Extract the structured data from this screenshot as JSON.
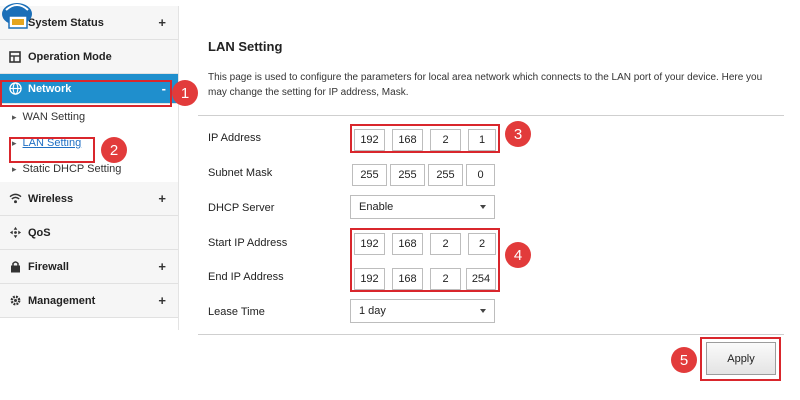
{
  "sidebar": {
    "items": [
      {
        "label": "System Status",
        "icon": "status-icon"
      },
      {
        "label": "Operation Mode",
        "icon": "mode-icon"
      },
      {
        "label": "Network",
        "icon": "globe-icon",
        "expanded": true
      },
      {
        "label": "Wireless",
        "icon": "wifi-icon"
      },
      {
        "label": "QoS",
        "icon": "qos-icon"
      },
      {
        "label": "Firewall",
        "icon": "lock-icon"
      },
      {
        "label": "Management",
        "icon": "gear-icon"
      }
    ],
    "network_sub": [
      {
        "label": "WAN Setting"
      },
      {
        "label": "LAN Setting",
        "current": true
      },
      {
        "label": "Static DHCP Setting"
      }
    ],
    "expand_symbol": "+",
    "collapse_symbol": "-",
    "bullet": "▸"
  },
  "main": {
    "title": "LAN Setting",
    "description": "This page is used to configure the parameters for local area network which connects to the LAN port of your device. Here you may change the setting for IP address, Mask.",
    "fields": {
      "ip_address": {
        "label": "IP Address",
        "octets": [
          "192",
          "168",
          "2",
          "1"
        ]
      },
      "subnet_mask": {
        "label": "Subnet Mask",
        "octets": [
          "255",
          "255",
          "255",
          "0"
        ]
      },
      "dhcp_server": {
        "label": "DHCP Server",
        "value": "Enable"
      },
      "start_ip": {
        "label": "Start IP Address",
        "octets": [
          "192",
          "168",
          "2",
          "2"
        ]
      },
      "end_ip": {
        "label": "End IP Address",
        "octets": [
          "192",
          "168",
          "2",
          "254"
        ]
      },
      "lease_time": {
        "label": "Lease Time",
        "value": "1 day"
      }
    },
    "apply_label": "Apply"
  },
  "callouts": [
    "1",
    "2",
    "3",
    "4",
    "5"
  ],
  "colors": {
    "accent": "#1f8fcd",
    "callout": "#e23b3b",
    "link": "#1f6fc4"
  }
}
